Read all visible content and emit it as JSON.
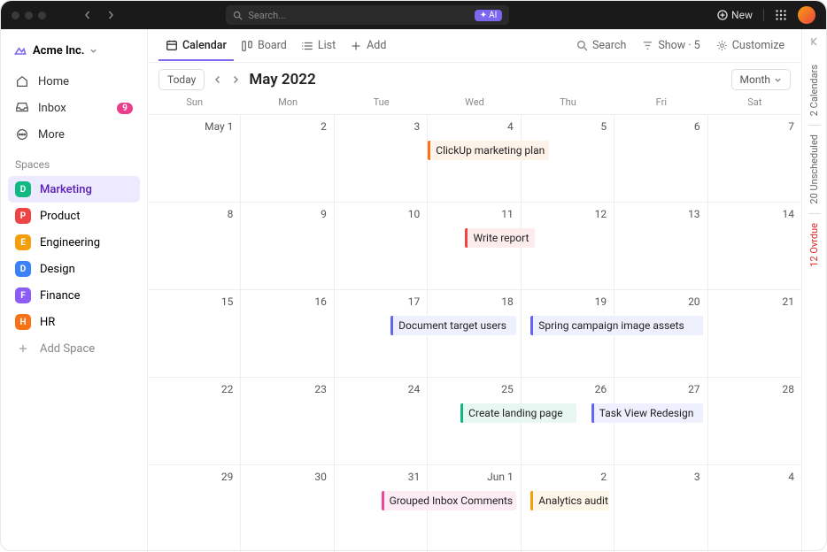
{
  "titlebar": {
    "search_placeholder": "Search...",
    "ai": "AI",
    "new": "New"
  },
  "workspace": {
    "name": "Acme Inc."
  },
  "nav": [
    {
      "label": "Home",
      "icon": "home"
    },
    {
      "label": "Inbox",
      "icon": "inbox",
      "badge": "9"
    },
    {
      "label": "More",
      "icon": "more"
    }
  ],
  "spaces_header": "Spaces",
  "spaces": [
    {
      "letter": "D",
      "label": "Marketing",
      "color": "#10b981",
      "active": true
    },
    {
      "letter": "P",
      "label": "Product",
      "color": "#ef4444"
    },
    {
      "letter": "E",
      "label": "Engineering",
      "color": "#f59e0b"
    },
    {
      "letter": "D",
      "label": "Design",
      "color": "#3b82f6"
    },
    {
      "letter": "F",
      "label": "Finance",
      "color": "#8b5cf6"
    },
    {
      "letter": "H",
      "label": "HR",
      "color": "#f97316"
    }
  ],
  "add_space": "Add Space",
  "views": [
    {
      "label": "Calendar",
      "icon": "calendar",
      "active": true
    },
    {
      "label": "Board",
      "icon": "board"
    },
    {
      "label": "List",
      "icon": "list"
    },
    {
      "label": "Add",
      "icon": "plus"
    }
  ],
  "toolbar_right": {
    "search": "Search",
    "show": "Show · 5",
    "customize": "Customize"
  },
  "subbar": {
    "today": "Today",
    "title": "May 2022",
    "month_sel": "Month"
  },
  "dow": [
    "Sun",
    "Mon",
    "Tue",
    "Wed",
    "Thu",
    "Fri",
    "Sat"
  ],
  "cells": [
    "May 1",
    "2",
    "3",
    "4",
    "5",
    "6",
    "7",
    "8",
    "9",
    "10",
    "11",
    "12",
    "13",
    "14",
    "15",
    "16",
    "17",
    "18",
    "19",
    "20",
    "21",
    "22",
    "23",
    "24",
    "25",
    "26",
    "27",
    "28",
    "29",
    "30",
    "31",
    "Jun 1",
    "2",
    "3",
    "4"
  ],
  "events": [
    {
      "label": "ClickUp marketing plan",
      "row": 0,
      "start": 3,
      "span": 1.35,
      "color": "#f97316",
      "bg": "#fef3e8"
    },
    {
      "label": "Write report",
      "row": 1,
      "start": 3.4,
      "span": 0.8,
      "color": "#ef4444",
      "bg": "#fdecec"
    },
    {
      "label": "Document target users",
      "row": 2,
      "start": 2.6,
      "span": 1.4,
      "color": "#6366f1",
      "bg": "#eef0fd"
    },
    {
      "label": "Spring campaign image assets",
      "row": 2,
      "start": 4.1,
      "span": 1.9,
      "color": "#6366f1",
      "bg": "#eef0fd"
    },
    {
      "label": "Create landing page",
      "row": 3,
      "start": 3.35,
      "span": 1.3,
      "color": "#10b981",
      "bg": "#e8f7f1"
    },
    {
      "label": "Task View Redesign",
      "row": 3,
      "start": 4.75,
      "span": 1.25,
      "color": "#6366f1",
      "bg": "#eef0fd"
    },
    {
      "label": "Grouped Inbox Comments",
      "row": 4,
      "start": 2.5,
      "span": 1.5,
      "color": "#ec4899",
      "bg": "#fdecf4"
    },
    {
      "label": "Analytics audit",
      "row": 4,
      "start": 4.1,
      "span": 0.9,
      "color": "#f59e0b",
      "bg": "#fef6e8"
    }
  ],
  "rail": {
    "calendars": "2 Calendars",
    "unscheduled": "20 Unscheduled",
    "overdue": "12 Ovrdue"
  }
}
